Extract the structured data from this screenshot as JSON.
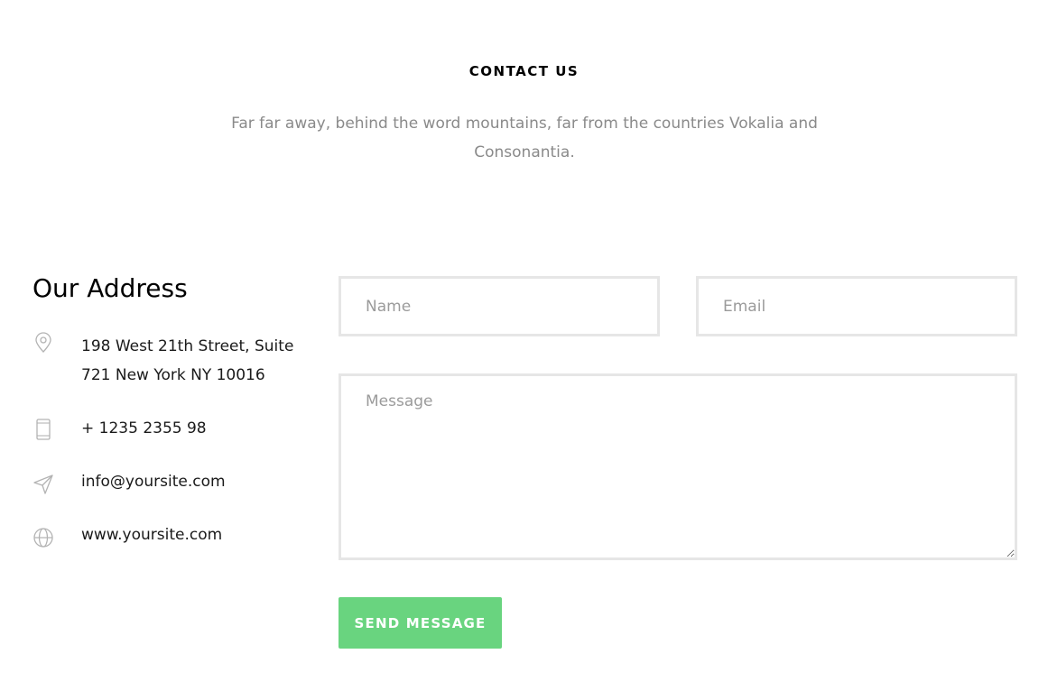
{
  "section": {
    "heading": "CONTACT US",
    "intro": "Far far away, behind the word mountains, far from the countries Vokalia and Consonantia."
  },
  "address": {
    "title": "Our Address",
    "items": [
      {
        "icon": "map-pin-icon",
        "text": "198 West 21th Street, Suite 721 New York NY 10016"
      },
      {
        "icon": "phone-icon",
        "text": "+ 1235 2355 98"
      },
      {
        "icon": "send-icon",
        "text": "info@yoursite.com"
      },
      {
        "icon": "globe-icon",
        "text": "www.yoursite.com"
      }
    ]
  },
  "form": {
    "name_placeholder": "Name",
    "name_value": "",
    "email_placeholder": "Email",
    "email_value": "",
    "message_placeholder": "Message",
    "message_value": "",
    "submit_label": "SEND MESSAGE"
  },
  "colors": {
    "accent": "#69d47f",
    "icon": "#b3b3b3",
    "muted_text": "#8a8a8a",
    "border": "#e6e6e6"
  }
}
